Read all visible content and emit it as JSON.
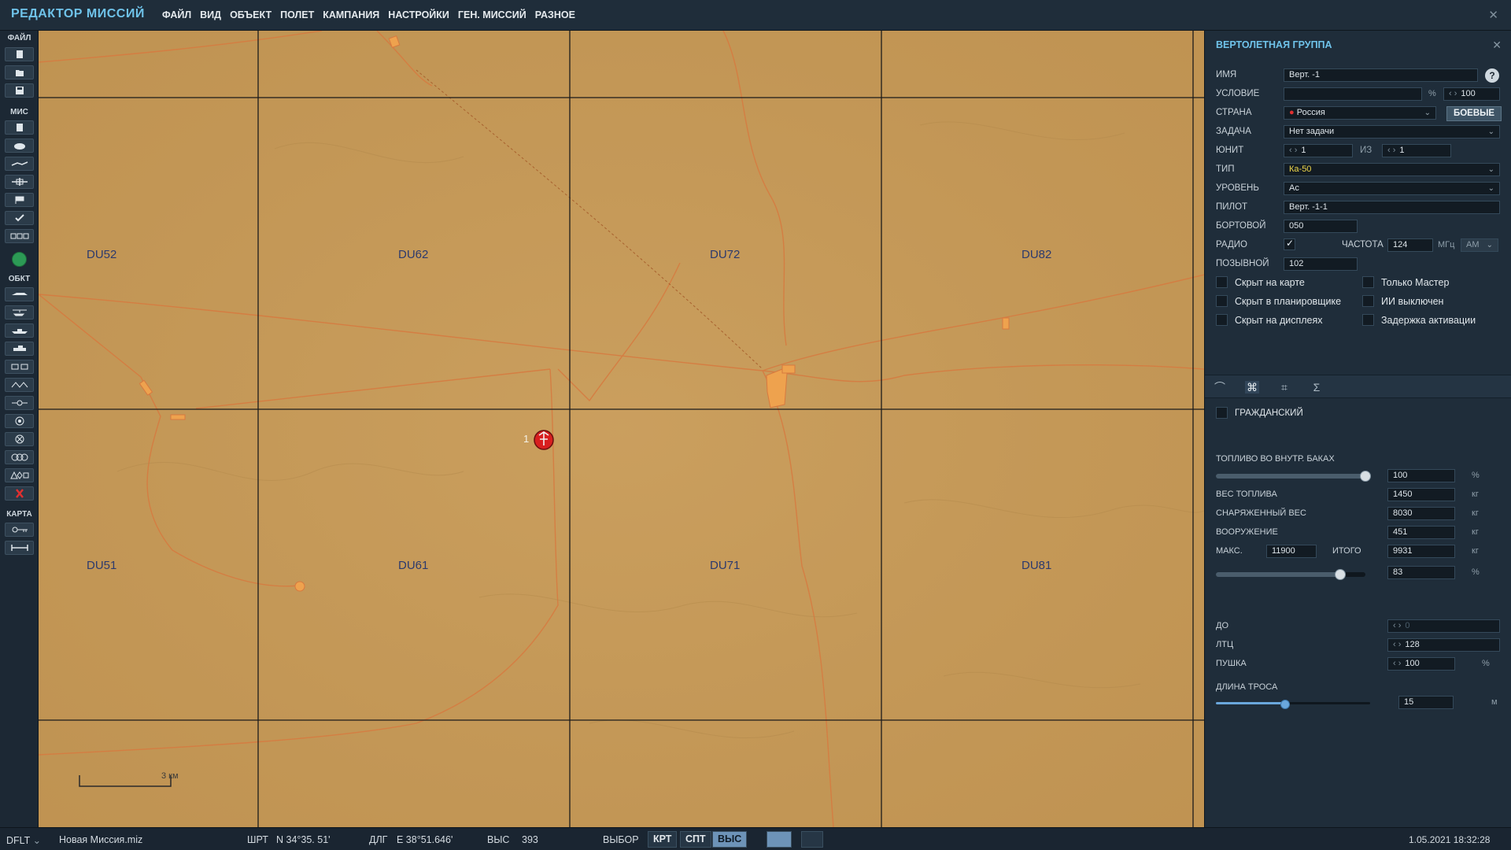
{
  "app": {
    "title": "РЕДАКТОР МИССИЙ",
    "close_icon": "close-icon"
  },
  "menu": [
    "ФАЙЛ",
    "ВИД",
    "ОБЪЕКТ",
    "ПОЛЕТ",
    "КАМПАНИЯ",
    "НАСТРОЙКИ",
    "ГЕН. МИССИЙ",
    "РАЗНОЕ"
  ],
  "toolbar": {
    "sections": [
      "ФАЙЛ",
      "МИС",
      "ОБКТ",
      "КАРТА"
    ]
  },
  "map": {
    "grid_labels": [
      "DU52",
      "DU62",
      "DU72",
      "DU82",
      "DU51",
      "DU61",
      "DU71",
      "DU81"
    ],
    "unit_number": "1",
    "scale": "3 км",
    "colors": {
      "terrain": "#c69a58",
      "roads": "#d7793f",
      "town": "#eea24e",
      "grid": "#1b1b1b",
      "unit": "#d81f1f"
    }
  },
  "panel": {
    "title": "ВЕРТОЛЕТНАЯ ГРУППА",
    "labels": {
      "name": "ИМЯ",
      "condition": "УСЛОВИЕ",
      "country": "СТРАНА",
      "task": "ЗАДАЧА",
      "unit": "ЮНИТ",
      "of": "ИЗ",
      "type": "ТИП",
      "level": "УРОВЕНЬ",
      "pilot": "ПИЛОТ",
      "tail": "БОРТОВОЙ",
      "radio": "РАДИО",
      "freq": "ЧАСТОТА",
      "freq_unit": "МГц",
      "callsign": "ПОЗЫВНОЙ"
    },
    "values": {
      "name": "Верт. -1",
      "condition": "",
      "condition_pct_sign": "%",
      "condition_pct": "100",
      "country": "Россия",
      "combat_button": "БОЕВЫЕ",
      "task": "Нет задачи",
      "unit": "1",
      "unit_of": "1",
      "type": "Ка-50",
      "level": "Ас",
      "pilot": "Верт. -1-1",
      "tail": "050",
      "radio_checked": true,
      "freq": "124",
      "modulation": "AM",
      "callsign": "102"
    },
    "checkboxes": [
      "Скрыт на карте",
      "Только Мастер",
      "Скрыт в планировщике",
      "ИИ выключен",
      "Скрыт на дисплеях",
      "Задержка активации"
    ],
    "tab_icons": [
      "route-icon",
      "payload-icon",
      "properties-icon",
      "summary-icon"
    ],
    "civil_label": "ГРАЖДАНСКИЙ",
    "fuel": {
      "title": "ТОПЛИВО ВО ВНУТР. БАКАХ",
      "pct": "100",
      "pct_unit": "%",
      "fill_fraction": 1.0,
      "rows": [
        {
          "label": "ВЕС ТОПЛИВА",
          "value": "1450",
          "unit": "кг"
        },
        {
          "label": "СНАРЯЖЕННЫЙ ВЕС",
          "value": "8030",
          "unit": "кг"
        },
        {
          "label": "ВООРУЖЕНИЕ",
          "value": "451",
          "unit": "кг"
        }
      ],
      "max_label": "МАКС.",
      "max_value": "11900",
      "total_label": "ИТОГО",
      "total_value": "9931",
      "total_unit": "кг",
      "load_pct": "83",
      "load_fraction": 0.83
    },
    "ammo": {
      "do_label": "ДО",
      "do_value": "0",
      "ltc_label": "ЛТЦ",
      "ltc_value": "128",
      "gun_label": "ПУШКА",
      "gun_value": "100",
      "gun_unit": "%"
    },
    "rope": {
      "label": "ДЛИНА ТРОСА",
      "value": "15",
      "unit": "м",
      "fraction": 0.45
    }
  },
  "status": {
    "profile": "DFLT",
    "file": "Новая Миссия.miz",
    "lat_label": "ШРТ",
    "lat": "N 34°35. 51'",
    "lon_label": "ДЛГ",
    "lon": "E 38°51.646'",
    "alt_label": "ВЫС",
    "alt": "393",
    "select_label": "ВЫБОР",
    "btn_map": "КРТ",
    "btn_sat": "СПТ",
    "btn_alt": "ВЫС",
    "datetime": "1.05.2021 18:32:28"
  }
}
